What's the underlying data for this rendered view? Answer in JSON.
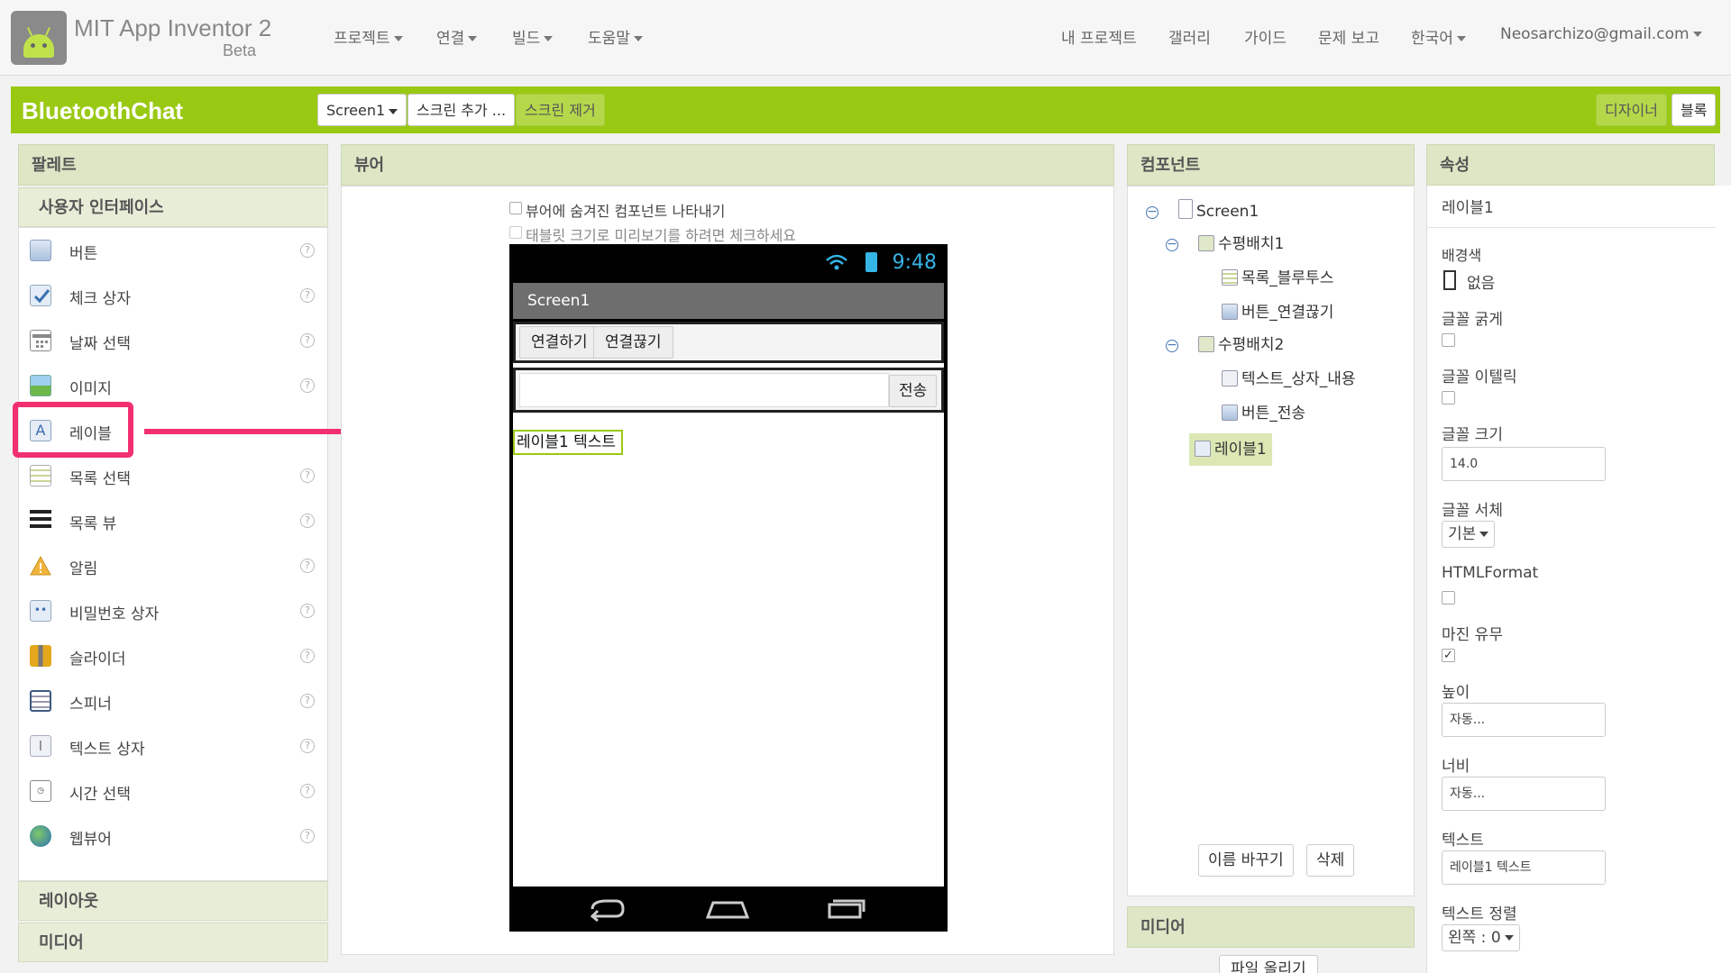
{
  "app": {
    "title": "MIT App Inventor 2",
    "subtitle": "Beta"
  },
  "topmenu": {
    "left": [
      "프로젝트",
      "연결",
      "빌드",
      "도움말"
    ],
    "right": [
      "내 프로젝트",
      "갤러리",
      "가이드",
      "문제 보고",
      "한국어",
      "Neosarchizo@gmail.com"
    ]
  },
  "toolbar": {
    "project_name": "BluetoothChat",
    "screen_select": "Screen1",
    "add_screen": "스크린 추가 ...",
    "remove_screen": "스크린 제거",
    "designer": "디자이너",
    "blocks": "블록"
  },
  "palette": {
    "header": "팔레트",
    "category": "사용자 인터페이스",
    "items": [
      {
        "label": "버튼",
        "icon": "button-icon"
      },
      {
        "label": "체크 상자",
        "icon": "checkbox-icon"
      },
      {
        "label": "날짜 선택",
        "icon": "datepicker-icon"
      },
      {
        "label": "이미지",
        "icon": "image-icon"
      },
      {
        "label": "레이블",
        "icon": "label-icon"
      },
      {
        "label": "목록 선택",
        "icon": "listpicker-icon"
      },
      {
        "label": "목록 뷰",
        "icon": "listview-icon"
      },
      {
        "label": "알림",
        "icon": "notifier-icon"
      },
      {
        "label": "비밀번호 상자",
        "icon": "passwordtextbox-icon"
      },
      {
        "label": "슬라이더",
        "icon": "slider-icon"
      },
      {
        "label": "스피너",
        "icon": "spinner-icon"
      },
      {
        "label": "텍스트 상자",
        "icon": "textbox-icon"
      },
      {
        "label": "시간 선택",
        "icon": "timepicker-icon"
      },
      {
        "label": "웹뷰어",
        "icon": "webviewer-icon"
      }
    ],
    "help_glyph": "?",
    "groups": [
      "레이아웃",
      "미디어"
    ]
  },
  "viewer": {
    "header": "뷰어",
    "show_hidden": "뷰어에 숨겨진 컴포넌트 나타내기",
    "tablet_preview": "태블릿 크기로 미리보기를 하려면 체크하세요",
    "phone": {
      "time": "9:48",
      "screen_title": "Screen1",
      "connect_btn": "연결하기",
      "disconnect_btn": "연결끊기",
      "send_btn": "전송",
      "label_text": "레이블1 텍스트"
    }
  },
  "components": {
    "header": "컴포넌트",
    "tree": [
      {
        "name": "Screen1"
      },
      {
        "name": "수평배치1"
      },
      {
        "name": "목록_블루투스"
      },
      {
        "name": "버튼_연결끊기"
      },
      {
        "name": "수평배치2"
      },
      {
        "name": "텍스트_상자_내용"
      },
      {
        "name": "버튼_전송"
      },
      {
        "name": "레이블1"
      }
    ],
    "rename": "이름 바꾸기",
    "delete": "삭제"
  },
  "media": {
    "header": "미디어",
    "upload": "파일 올리기"
  },
  "properties": {
    "header": "속성",
    "component": "레이블1",
    "bgcolor_label": "배경색",
    "bgcolor_value": "없음",
    "bold_label": "글꼴 굵게",
    "italic_label": "글꼴 이텔릭",
    "fontsize_label": "글꼴 크기",
    "fontsize_value": "14.0",
    "typeface_label": "글꼴 서체",
    "typeface_value": "기본",
    "html_label": "HTMLFormat",
    "margin_label": "마진 유무",
    "margin_checked": true,
    "height_label": "높이",
    "height_value": "자동...",
    "width_label": "너비",
    "width_value": "자동...",
    "text_label": "텍스트",
    "text_value": "레이블1 텍스트",
    "align_label": "텍스트 정렬",
    "align_value": "왼쪽 : 0"
  },
  "colors": {
    "accent_green": "#9ac914",
    "highlight_pink": "#f2306f",
    "status_blue": "#35b4e6"
  }
}
